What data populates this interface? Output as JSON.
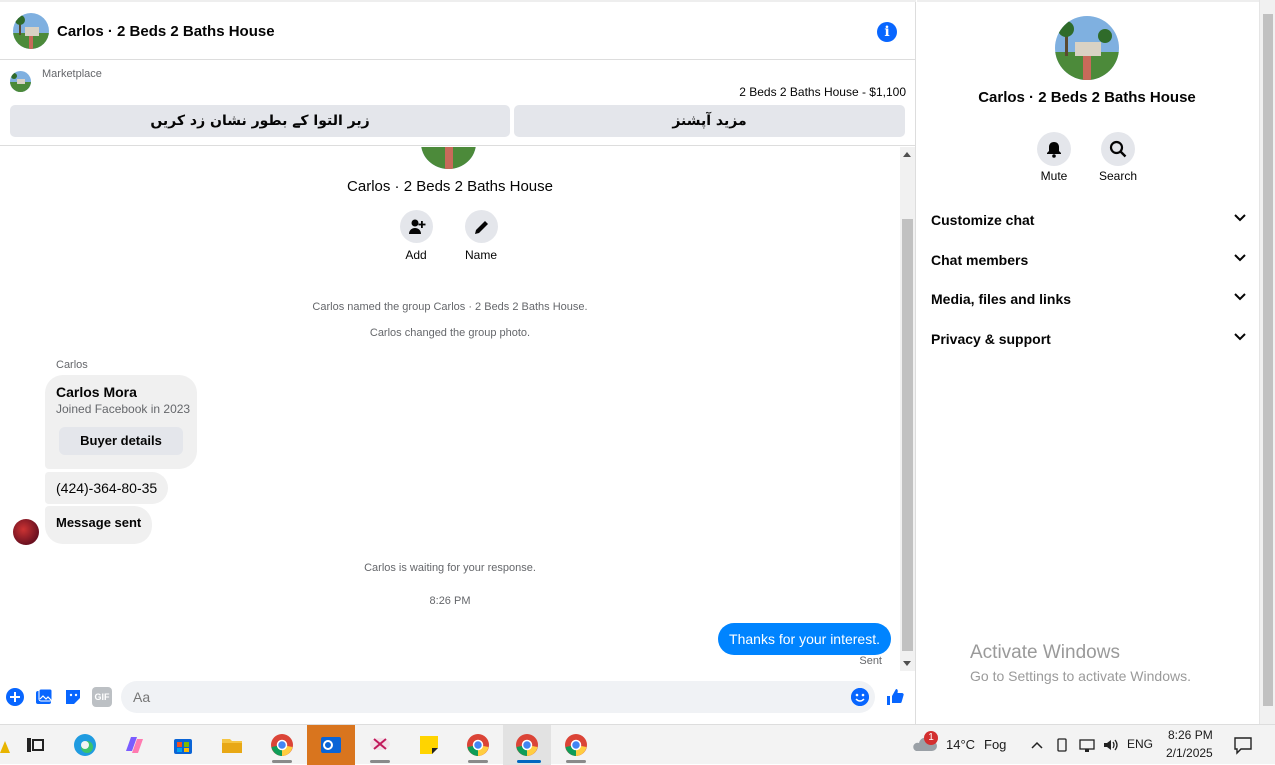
{
  "header": {
    "title": "Carlos · 2 Beds 2 Baths House",
    "info_icon": "i"
  },
  "marketplace": {
    "label": "Marketplace",
    "listing": "2 Beds 2 Baths House - $1,100",
    "mark_sold_label": "زیر التوا کے بطور نشان زد کریں",
    "more_options_label": "مزید آپشنز"
  },
  "conversation": {
    "group_name": "Carlos · 2 Beds 2 Baths House",
    "add_label": "Add",
    "name_label": "Name",
    "system_messages": [
      "Carlos named the group Carlos · 2 Beds 2 Baths House.",
      "Carlos changed the group photo."
    ],
    "sender_name": "Carlos",
    "profile_card": {
      "name": "Carlos Mora",
      "subtitle": "Joined Facebook in 2023",
      "button": "Buyer details"
    },
    "phone_message": "(424)-364-80-35",
    "status_message": "Message sent",
    "waiting_message": "Carlos is waiting for your response.",
    "timestamp": "8:26 PM",
    "outgoing_message": "Thanks for your interest.",
    "sent_status": "Sent"
  },
  "composer": {
    "placeholder": "Aa",
    "gif_label": "GIF"
  },
  "right_panel": {
    "title": "Carlos · 2 Beds 2 Baths House",
    "mute_label": "Mute",
    "search_label": "Search",
    "sections": [
      {
        "label": "Customize chat"
      },
      {
        "label": "Chat members"
      },
      {
        "label": "Media, files and links"
      },
      {
        "label": "Privacy & support"
      }
    ],
    "watermark_title": "Activate Windows",
    "watermark_sub": "Go to Settings to activate Windows."
  },
  "taskbar": {
    "weather_badge": "1",
    "weather": "14°C",
    "weather_desc": "Fog",
    "language": "ENG",
    "time": "8:26 PM",
    "date": "2/1/2025"
  },
  "colors": {
    "accent": "#0866ff",
    "outgoing_bubble": "#0084ff",
    "incoming_bubble": "#f0f0f0"
  }
}
